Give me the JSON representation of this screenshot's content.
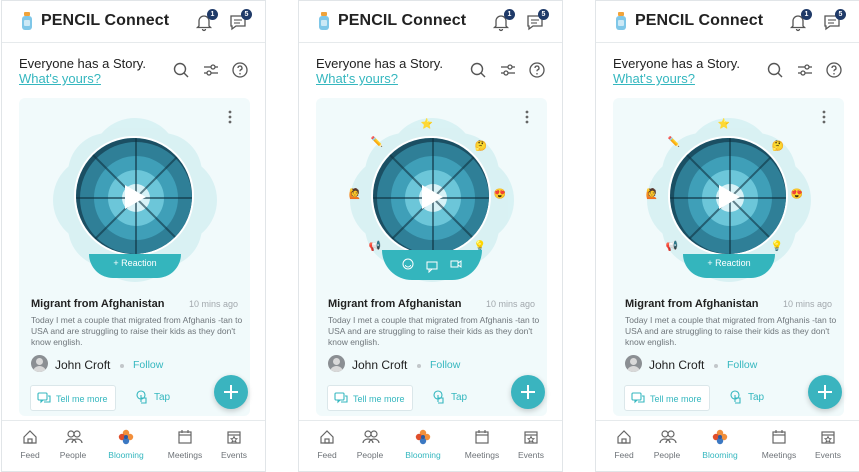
{
  "colors": {
    "accent": "#35b7bf",
    "badge": "#1f3a68",
    "card_bg": "#f1fafb"
  },
  "app": {
    "title": "PENCIL Connect",
    "notification_count": "1",
    "message_count": "5"
  },
  "feed": {
    "headline": "Everyone has a Story.",
    "prompt_link": "What's yours?",
    "post": {
      "title": "Migrant from Afghanistan",
      "time": "10 mins ago",
      "body": "Today I met a couple that migrated from Afghanis -tan to USA and are struggling to raise their kids as they don't know english.",
      "author": "John Croft",
      "follow_label": "Follow",
      "reaction_label": "+ Reaction",
      "tell_label": "Tell me more",
      "tap_label": "Tap"
    }
  },
  "nav": [
    {
      "label": "Feed",
      "icon": "home-icon"
    },
    {
      "label": "People",
      "icon": "people-icon"
    },
    {
      "label": "Blooming",
      "icon": "blooming-flower-icon"
    },
    {
      "label": "Meetings",
      "icon": "calendar-icon"
    },
    {
      "label": "Events",
      "icon": "event-star-calendar-icon"
    }
  ],
  "screens": [
    {
      "state": "default"
    },
    {
      "state": "reaction-tray-open"
    },
    {
      "state": "reactions-shown"
    }
  ]
}
